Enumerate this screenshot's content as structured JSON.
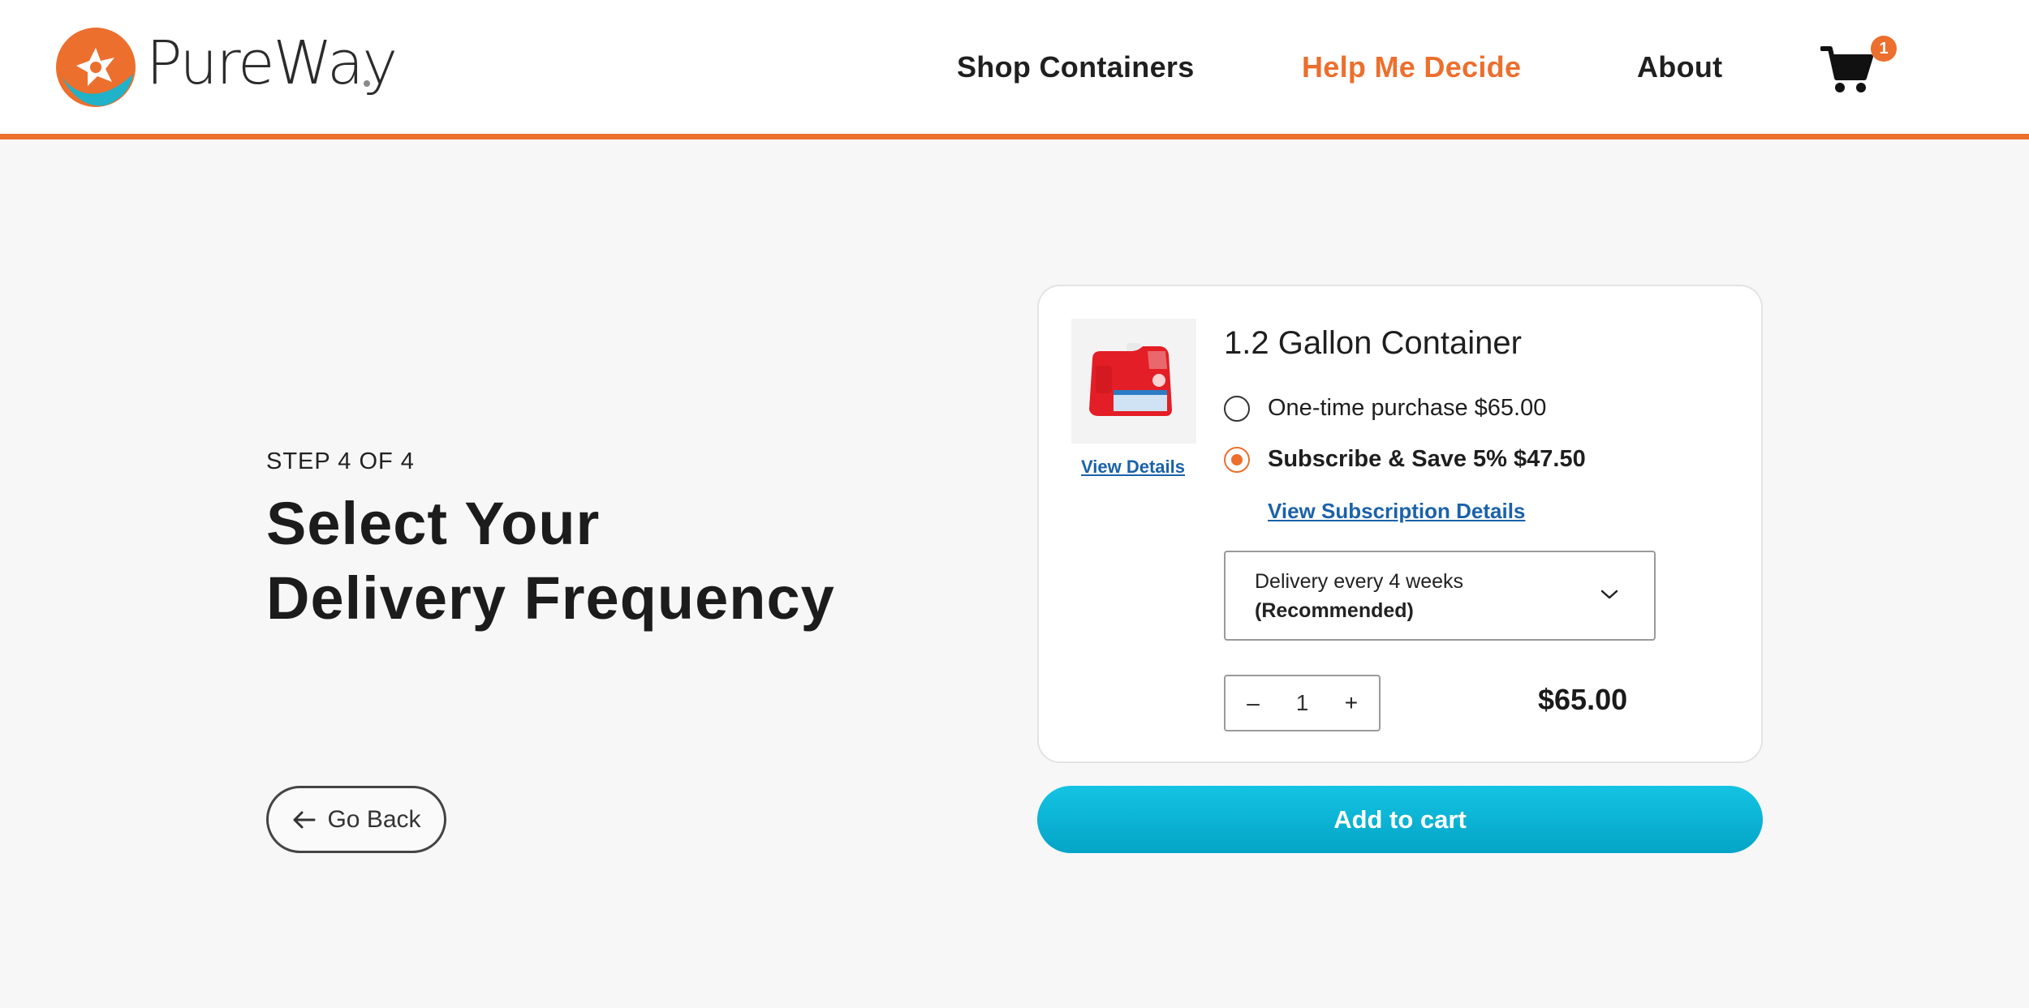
{
  "brand": {
    "name": "PureWay"
  },
  "nav": {
    "items": [
      {
        "label": "Shop Containers",
        "active": false
      },
      {
        "label": "Help Me Decide",
        "active": true
      },
      {
        "label": "About",
        "active": false
      }
    ],
    "cart_count": "1",
    "cart_icon": "cart-icon"
  },
  "step": {
    "label": "STEP 4 OF 4",
    "title_line1": "Select Your",
    "title_line2": "Delivery Frequency"
  },
  "back_button": {
    "label": "Go Back",
    "icon": "arrow-left-icon"
  },
  "product": {
    "name": "1.2 Gallon Container",
    "view_details": "View Details",
    "options": [
      {
        "label": "One-time purchase $65.00",
        "selected": false
      },
      {
        "label": "Subscribe & Save 5% $47.50",
        "selected": true
      }
    ],
    "subscription_details_link": "View Subscription Details",
    "frequency": {
      "line1": "Delivery every 4 weeks",
      "line2": "(Recommended)"
    },
    "quantity": "1",
    "minus": "–",
    "plus": "+",
    "price": "$65.00"
  },
  "add_to_cart": "Add to cart",
  "colors": {
    "accent": "#ec6f2d",
    "cta": "#08b3d6",
    "link": "#1b62a8"
  }
}
